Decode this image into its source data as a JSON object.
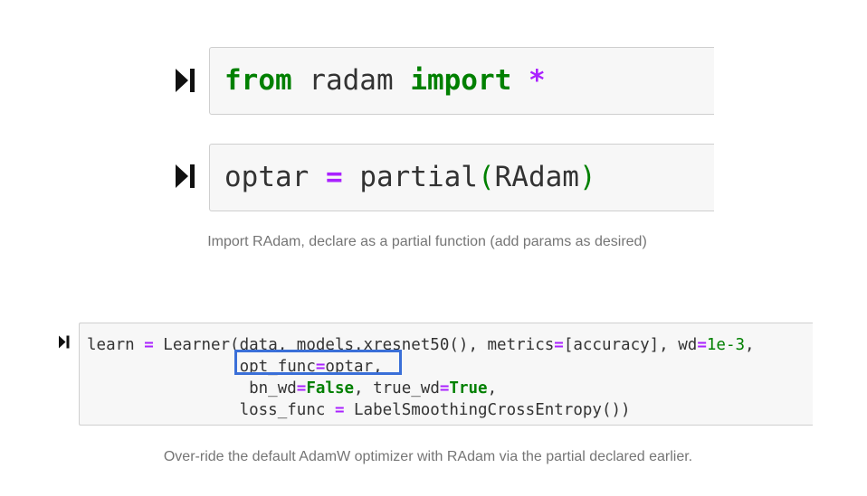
{
  "cells": [
    {
      "tokens": [
        {
          "text": "from",
          "kind": "kw"
        },
        {
          "text": " radam ",
          "kind": "plain"
        },
        {
          "text": "import",
          "kind": "kw"
        },
        {
          "text": " ",
          "kind": "plain"
        },
        {
          "text": "*",
          "kind": "op"
        }
      ]
    },
    {
      "tokens": [
        {
          "text": "optar ",
          "kind": "plain"
        },
        {
          "text": "=",
          "kind": "op"
        },
        {
          "text": " partial",
          "kind": "plain"
        },
        {
          "text": "(",
          "kind": "paren"
        },
        {
          "text": "RAdam",
          "kind": "plain"
        },
        {
          "text": ")",
          "kind": "paren"
        }
      ]
    },
    {
      "lines": [
        [
          {
            "text": "learn ",
            "kind": "plain"
          },
          {
            "text": "=",
            "kind": "op"
          },
          {
            "text": " Learner(data, models.xresnet50(), metrics",
            "kind": "plain"
          },
          {
            "text": "=",
            "kind": "op"
          },
          {
            "text": "[accuracy], wd",
            "kind": "plain"
          },
          {
            "text": "=",
            "kind": "op"
          },
          {
            "text": "1e-3",
            "kind": "num"
          },
          {
            "text": ",",
            "kind": "plain"
          }
        ],
        [
          {
            "text": "                opt_func",
            "kind": "plain"
          },
          {
            "text": "=",
            "kind": "op"
          },
          {
            "text": "optar,",
            "kind": "plain"
          }
        ],
        [
          {
            "text": "                 bn_wd",
            "kind": "plain"
          },
          {
            "text": "=",
            "kind": "op"
          },
          {
            "text": "False",
            "kind": "kw"
          },
          {
            "text": ", true_wd",
            "kind": "plain"
          },
          {
            "text": "=",
            "kind": "op"
          },
          {
            "text": "True",
            "kind": "kw"
          },
          {
            "text": ",",
            "kind": "plain"
          }
        ],
        [
          {
            "text": "                loss_func ",
            "kind": "plain"
          },
          {
            "text": "=",
            "kind": "op"
          },
          {
            "text": " LabelSmoothingCrossEntropy())",
            "kind": "plain"
          }
        ]
      ]
    }
  ],
  "captions": {
    "first": "Import RAdam, declare as a partial function (add params as desired)",
    "second": "Over-ride the default AdamW optimizer with RAdam via the partial declared earlier."
  },
  "icons": {
    "run": "run-cell-icon"
  },
  "colors": {
    "keyword": "#008000",
    "operator": "#aa22ff",
    "highlight": "#3a6fd8",
    "caption": "#757575",
    "cell_bg": "#f7f7f7"
  }
}
